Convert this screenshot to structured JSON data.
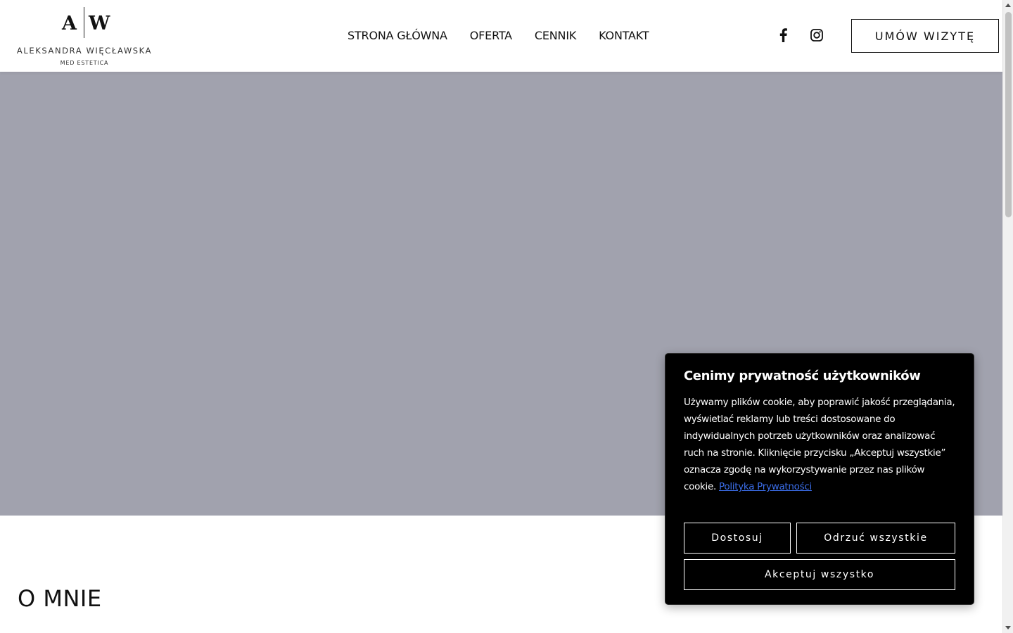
{
  "header": {
    "logo": {
      "letter_a": "A",
      "letter_w": "W",
      "name": "ALEKSANDRA WIĘCŁAWSKA",
      "subtitle": "MED ESTETICA"
    },
    "nav": [
      {
        "label": "STRONA GŁÓWNA"
      },
      {
        "label": "OFERTA"
      },
      {
        "label": "CENNIK"
      },
      {
        "label": "KONTAKT"
      }
    ],
    "social": {
      "facebook_icon": "facebook-icon",
      "instagram_icon": "instagram-icon"
    },
    "cta_label": "UMÓW WIZYTĘ"
  },
  "hero": {
    "background": "#a1a2ae"
  },
  "about": {
    "heading": "O MNIE"
  },
  "cookie": {
    "title": "Cenimy prywatność użytkowników",
    "text": "Używamy plików cookie, aby poprawić jakość przeglądania, wyświetlać reklamy lub treści dostosowane do indywidualnych potrzeb użytkowników oraz analizować ruch na stronie. Kliknięcie przycisku „Akceptuj wszystkie” oznacza zgodę na wykorzystywanie przez nas plików cookie.",
    "link_label": "Polityka Prywatności",
    "buttons": {
      "customize": "Dostosuj",
      "reject": "Odrzuć wszystkie",
      "accept": "Akceptuj wszystko"
    }
  }
}
